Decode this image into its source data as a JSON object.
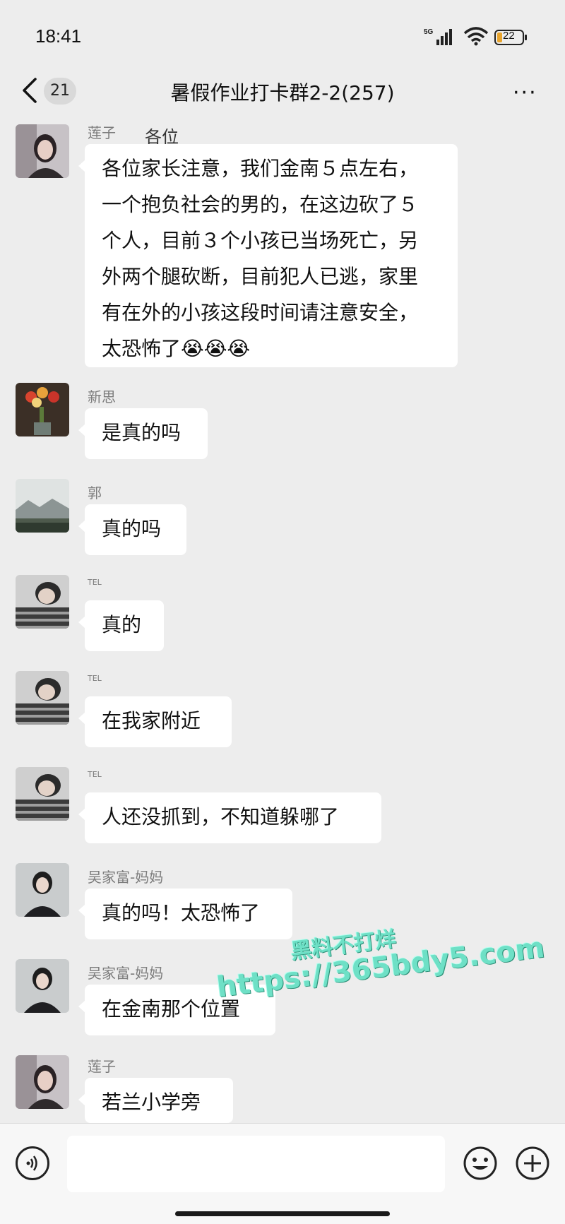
{
  "status_bar": {
    "time": "18:41",
    "network": "5G",
    "battery": "22"
  },
  "nav": {
    "unread_count": "21",
    "title": "暑假作业打卡群2-2(257)",
    "more_label": "···"
  },
  "chat": {
    "peek_text": "各位",
    "messages": [
      {
        "sender": "莲子",
        "text": "各位家长注意，我们金南５点左右，\n一个抱负社会的男的，在这边砍了５\n个人，目前３个小孩已当场死亡，另\n外两个腿砍断，目前犯人已逃，家里\n有在外的小孩这段时间请注意安全，\n太恐怖了😭😭😭"
      },
      {
        "sender": "新思",
        "text": "是真的吗"
      },
      {
        "sender": "郭",
        "text": "真的吗"
      },
      {
        "sender": "TEL",
        "text": "真的"
      },
      {
        "sender": "TEL",
        "text": "在我家附近"
      },
      {
        "sender": "TEL",
        "text": "人还没抓到，不知道躲哪了"
      },
      {
        "sender": "吴家富-妈妈",
        "text": "真的吗！太恐怖了"
      },
      {
        "sender": "吴家富-妈妈",
        "text": "在金南那个位置"
      },
      {
        "sender": "莲子",
        "text": "若兰小学旁"
      }
    ]
  },
  "watermark": {
    "line1": "黑料不打烊",
    "line2": "https://365bdy5.com"
  },
  "input_bar": {
    "value": "",
    "placeholder": ""
  },
  "icons": [
    "back-icon",
    "voice-icon",
    "emoji-icon",
    "plus-icon"
  ]
}
